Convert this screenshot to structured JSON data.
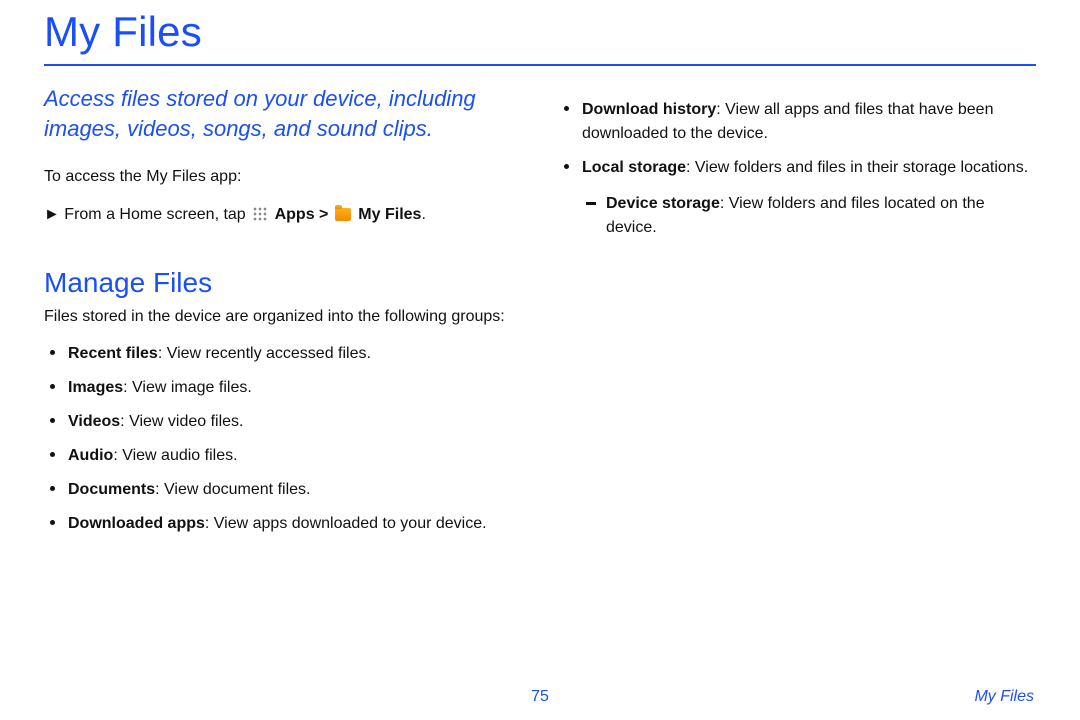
{
  "title": "My Files",
  "intro": "Access files stored on your device, including images, videos, songs, and sound clips.",
  "access_lead": "To access the My Files app:",
  "step": {
    "prefix": "From a Home screen, tap ",
    "apps_label": "Apps",
    "sep": " > ",
    "myfiles_label": "My Files",
    "period": "."
  },
  "section_heading": "Manage Files",
  "groups_lead": "Files stored in the device are organized into the following groups:",
  "groups_left": [
    {
      "term": "Recent files",
      "desc": ": View recently accessed files."
    },
    {
      "term": "Images",
      "desc": ": View image files."
    },
    {
      "term": "Videos",
      "desc": ": View video files."
    },
    {
      "term": "Audio",
      "desc": ": View audio files."
    },
    {
      "term": "Documents",
      "desc": ": View document files."
    },
    {
      "term": "Downloaded apps",
      "desc": ": View apps downloaded to your device."
    }
  ],
  "groups_right": [
    {
      "term": "Download history",
      "desc": ": View all apps and files that have been downloaded to the device."
    },
    {
      "term": "Local storage",
      "desc": ": View folders and files in their storage locations.",
      "sub": [
        {
          "term": "Device storage",
          "desc": ": View folders and files located on the device."
        }
      ]
    }
  ],
  "footer": {
    "page": "75",
    "section": "My Files"
  }
}
